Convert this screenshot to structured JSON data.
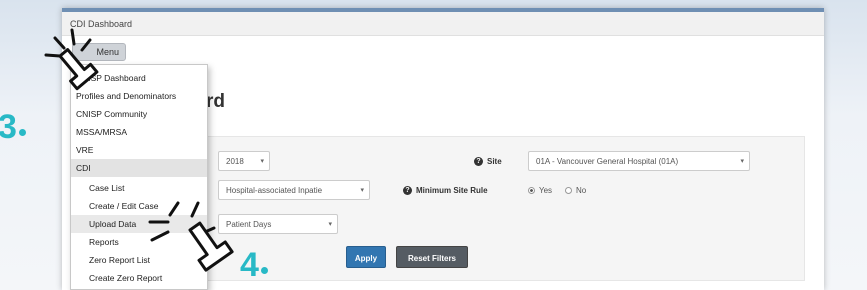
{
  "window": {
    "title": "CDI Dashboard"
  },
  "menu_button": {
    "label": "Menu"
  },
  "page_heading": "rd",
  "menu": {
    "items": [
      {
        "label": "CNISP Dashboard"
      },
      {
        "label": "Profiles and Denominators"
      },
      {
        "label": "CNISP Community"
      },
      {
        "label": "MSSA/MRSA"
      },
      {
        "label": "VRE"
      },
      {
        "label": "CDI"
      }
    ],
    "cdi_subitems": [
      {
        "label": "Case List"
      },
      {
        "label": "Create / Edit Case"
      },
      {
        "label": "Upload Data"
      },
      {
        "label": "Reports"
      },
      {
        "label": "Zero Report List"
      },
      {
        "label": "Create Zero Report"
      }
    ]
  },
  "filters": {
    "year": "2018",
    "case_type": "Hospital-associated Inpatie",
    "denominator": "Patient Days",
    "site_label": "Site",
    "site_value": "01A - Vancouver General Hospital (01A)",
    "min_site_rule_label": "Minimum Site Rule",
    "radio_yes": "Yes",
    "radio_no": "No",
    "min_site_rule_selected": "Yes"
  },
  "buttons": {
    "apply": "Apply",
    "reset": "Reset Filters"
  },
  "annotations": {
    "step3": "3",
    "step4": "4"
  },
  "colors": {
    "accent": "#28b9c6",
    "apply_button": "#3276b1",
    "reset_button": "#555c63"
  },
  "icons": {
    "info": "info-icon",
    "caret": "caret-down-icon",
    "cursor": "hand-cursor-icon",
    "click_burst": "click-burst-icon"
  }
}
